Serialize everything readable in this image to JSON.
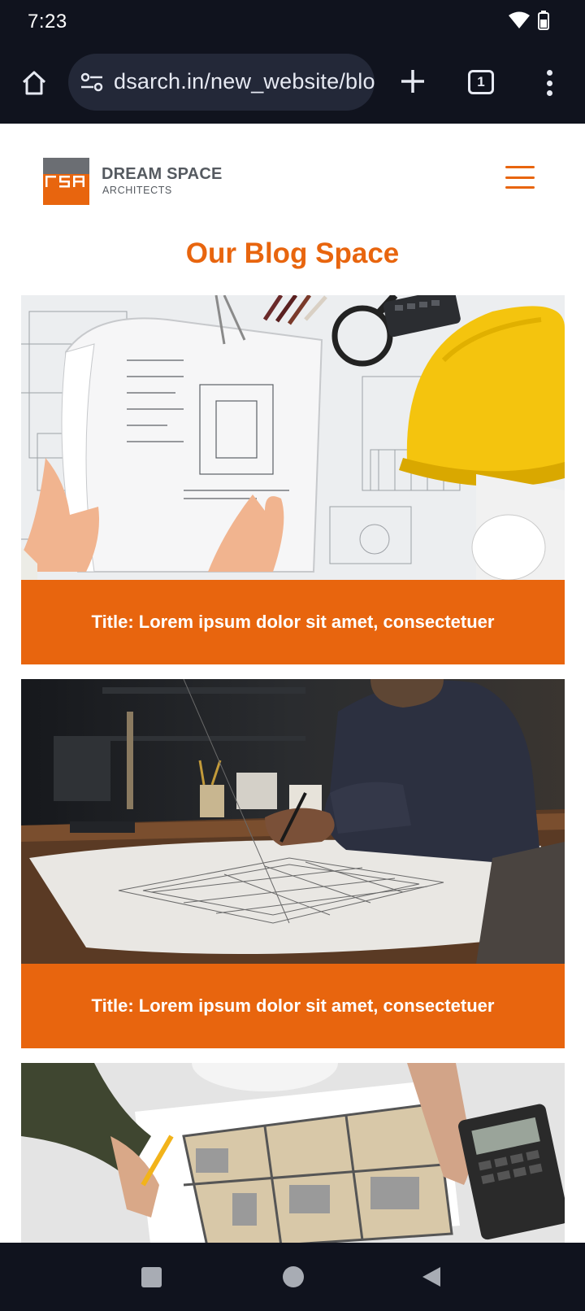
{
  "status": {
    "time": "7:23"
  },
  "browser": {
    "url": "dsarch.in/new_website/blog",
    "tab_count": "1"
  },
  "site": {
    "brand_name": "DREAM SPACE",
    "brand_sub": "ARCHITECTS",
    "accent_color": "#e8650e"
  },
  "page": {
    "title": "Our Blog Space"
  },
  "posts": [
    {
      "title": "Title: Lorem ipsum dolor sit amet, consectetuer",
      "image": "blueprint-helmet-image"
    },
    {
      "title": "Title: Lorem ipsum dolor sit amet, consectetuer",
      "image": "architect-drawing-image"
    },
    {
      "title": "",
      "image": "floor-plan-image"
    }
  ],
  "icons": {
    "home": "home-icon",
    "site_settings": "tune-icon",
    "new_tab": "plus-icon",
    "more": "more-vert-icon",
    "wifi": "wifi-icon",
    "battery": "battery-icon"
  }
}
